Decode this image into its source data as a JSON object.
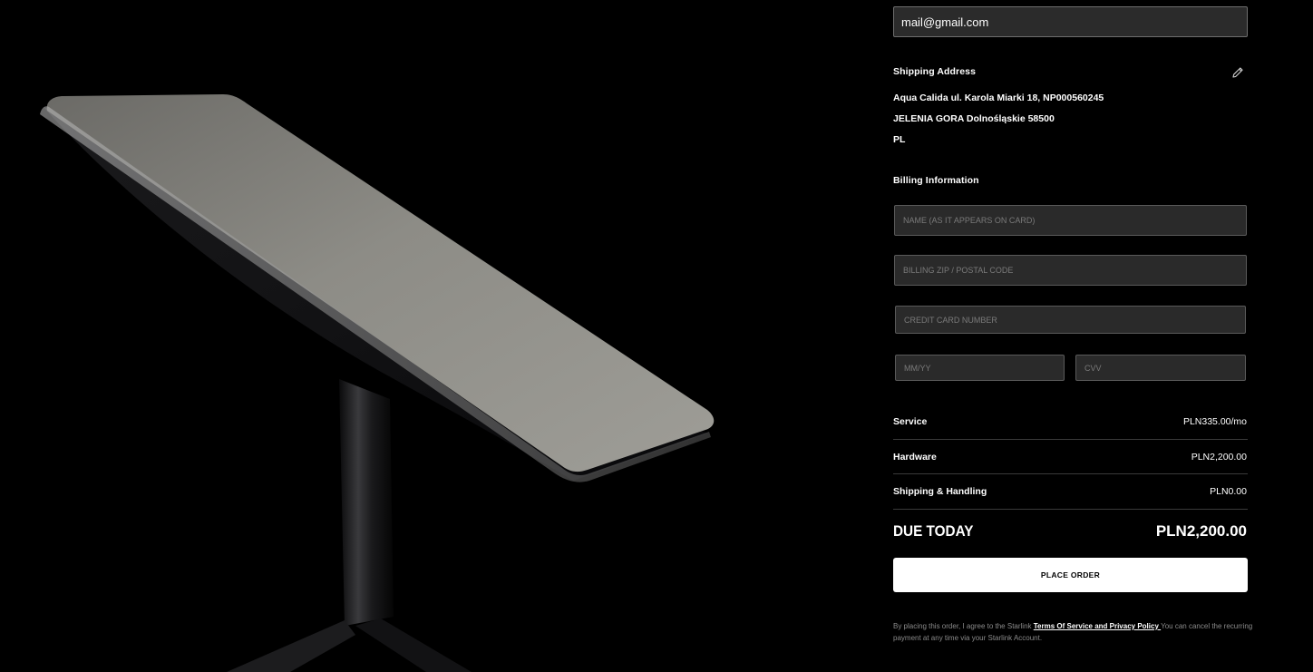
{
  "contact": {
    "email_value": "mail@gmail.com"
  },
  "shipping": {
    "title": "Shipping Address",
    "edit_icon": "pencil-icon",
    "line1": "Aqua Calida ul. Karola Miarki 18, NP000560245",
    "line2": "JELENIA GORA Dolnośląskie 58500",
    "line3": "PL"
  },
  "billing": {
    "title": "Billing Information",
    "name_placeholder": "NAME (AS IT APPEARS ON CARD)",
    "zip_placeholder": "BILLING ZIP / POSTAL CODE",
    "card_placeholder": "CREDIT CARD NUMBER",
    "expiry_placeholder": "MM/YY",
    "cvv_placeholder": "CVV"
  },
  "summary": {
    "service_label": "Service",
    "service_value": "PLN335.00/mo",
    "hardware_label": "Hardware",
    "hardware_value": "PLN2,200.00",
    "shipping_label": "Shipping & Handling",
    "shipping_value": "PLN0.00",
    "due_label": "DUE TODAY",
    "due_value": "PLN2,200.00"
  },
  "order": {
    "button_label": "PLACE ORDER"
  },
  "legal": {
    "prefix": "By placing this order, I agree to the Starlink ",
    "link_text": "Terms Of Service and Privacy Policy ",
    "suffix": " You can cancel the recurring payment at any time via your Starlink Account."
  },
  "colors": {
    "background": "#000000",
    "input_bg": "#2a2a2a",
    "button_bg": "#ffffff"
  }
}
